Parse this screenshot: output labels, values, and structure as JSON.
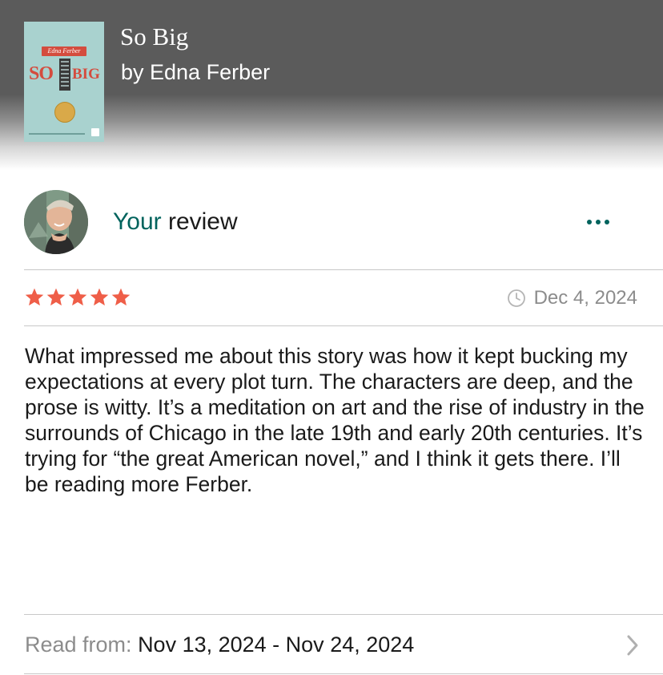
{
  "book": {
    "title": "So Big",
    "author_line": "by Edna Ferber",
    "cover": {
      "author": "Edna Ferber",
      "title_left": "SO",
      "title_right": "BIG"
    }
  },
  "review": {
    "heading_accent": "Your",
    "heading_rest": " review",
    "menu_icon": "more-dots-icon",
    "rating": 5,
    "max_rating": 5,
    "date": "Dec 4, 2024",
    "body": "What impressed me about this story was how it kept bucking my expectations at every plot turn. The characters are deep, and the prose is witty. It’s a meditation on art and the rise of industry in the surrounds of Chicago in the late 19th and early 20th centuries. It’s trying for “the great American novel,” and I think it gets there. I’ll be reading more Ferber."
  },
  "read": {
    "label": "Read from: ",
    "dates": "Nov 13, 2024 - Nov 24, 2024"
  },
  "colors": {
    "accent": "#00635d",
    "star": "#ef5e48",
    "header_bg": "#5b5b5b",
    "muted_text": "#8c8c8c"
  }
}
